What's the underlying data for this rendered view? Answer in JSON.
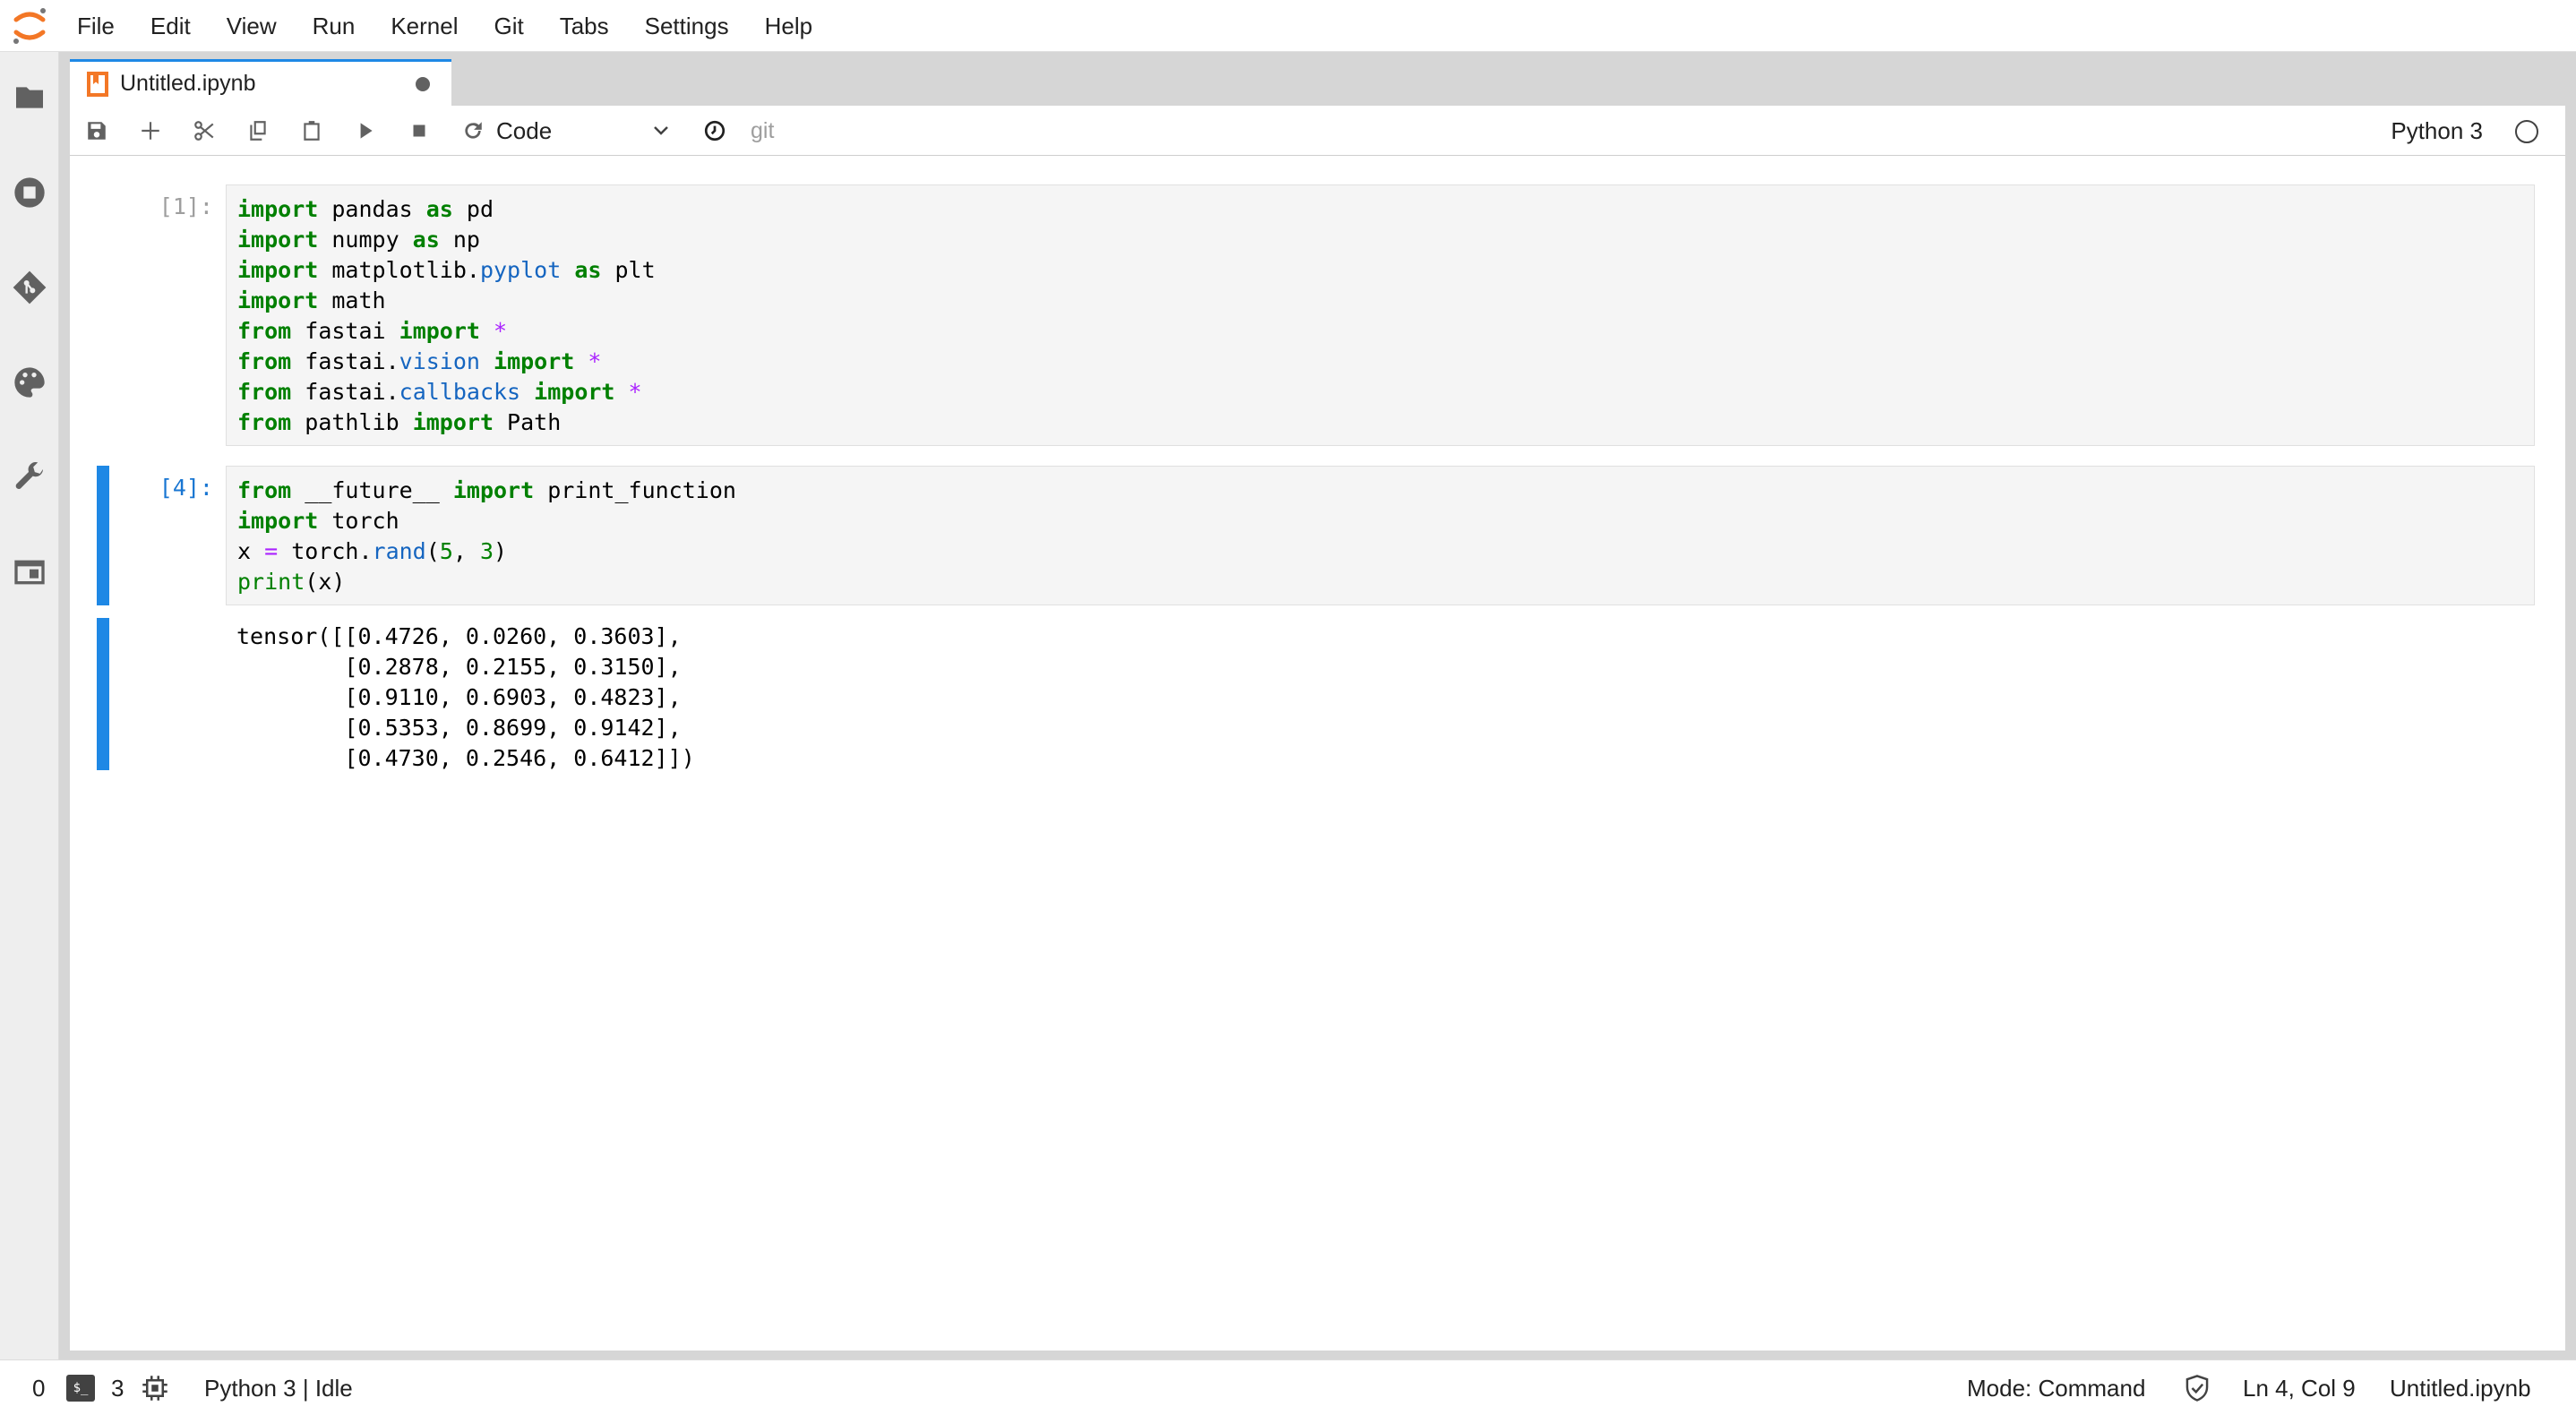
{
  "menu": {
    "items": [
      "File",
      "Edit",
      "View",
      "Run",
      "Kernel",
      "Git",
      "Tabs",
      "Settings",
      "Help"
    ]
  },
  "sidebar": {
    "icons": [
      "folder-icon",
      "running-icon",
      "git-icon",
      "palette-icon",
      "wrench-icon",
      "tabs-icon"
    ]
  },
  "tab": {
    "label": "Untitled.ipynb"
  },
  "toolbar": {
    "cell_type": "Code",
    "git_label": "git",
    "kernel_name": "Python 3"
  },
  "cells": [
    {
      "prompt": "[1]:",
      "lines": [
        "import pandas as pd",
        "import numpy as np",
        "import matplotlib.pyplot as plt",
        "import math",
        "from fastai import *",
        "from fastai.vision import *",
        "from fastai.callbacks import *",
        "from pathlib import Path"
      ]
    },
    {
      "prompt": "[4]:",
      "lines": [
        "from __future__ import print_function",
        "import torch",
        "x = torch.rand(5, 3)",
        "print(x)"
      ],
      "output": [
        "tensor([[0.4726, 0.0260, 0.3603],",
        "        [0.2878, 0.2155, 0.3150],",
        "        [0.9110, 0.6903, 0.4823],",
        "        [0.5353, 0.8699, 0.9142],",
        "        [0.4730, 0.2546, 0.6412]])"
      ]
    }
  ],
  "statusbar": {
    "left_count": "0",
    "terminal_count": "3",
    "kernel_status": "Python 3 | Idle",
    "mode": "Mode: Command",
    "cursor": "Ln 4, Col 9",
    "file": "Untitled.ipynb"
  },
  "colors": {
    "accent": "#1e88e5",
    "keyword": "#008000",
    "attribute": "#1565c0",
    "operator": "#aa22ff"
  }
}
